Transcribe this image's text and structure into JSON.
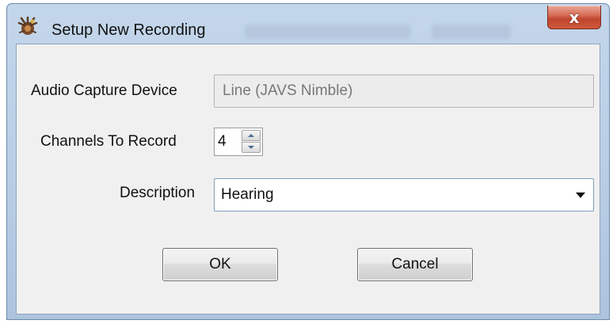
{
  "window": {
    "title": "Setup New Recording",
    "close_label": "x"
  },
  "form": {
    "audio_capture_device": {
      "label": "Audio Capture Device",
      "value": "Line (JAVS Nimble)"
    },
    "channels_to_record": {
      "label": "Channels To Record",
      "value": "4"
    },
    "description": {
      "label": "Description",
      "value": "Hearing"
    }
  },
  "buttons": {
    "ok_label": "OK",
    "cancel_label": "Cancel"
  },
  "icons": {
    "app": "recording-app-icon",
    "close": "close-icon",
    "spin_up": "arrow-up-icon",
    "spin_down": "arrow-down-icon",
    "dropdown": "chevron-down-icon"
  },
  "colors": {
    "frame": "#b8cde4",
    "client_background": "#f0f0f0",
    "close_button": "#c0442c",
    "combo_border": "#7f9db9"
  }
}
